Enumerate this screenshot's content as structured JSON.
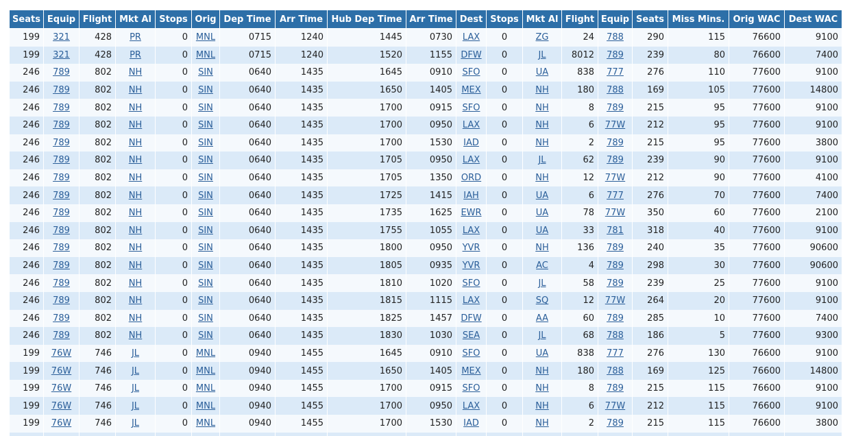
{
  "table": {
    "headers": [
      "Seats",
      "Equip",
      "Flight",
      "Mkt Al",
      "Stops",
      "Orig",
      "Dep Time",
      "Arr Time",
      "Hub Dep Time",
      "Arr Time",
      "Dest",
      "Stops",
      "Mkt Al",
      "Flight",
      "Equip",
      "Seats",
      "Miss Mins.",
      "Orig WAC",
      "Dest WAC"
    ],
    "rows": [
      [
        "199",
        "321",
        "428",
        "PR",
        "0",
        "MNL",
        "0715",
        "1240",
        "1445",
        "0730",
        "LAX",
        "0",
        "ZG",
        "24",
        "788",
        "290",
        "115",
        "76600",
        "9100"
      ],
      [
        "199",
        "321",
        "428",
        "PR",
        "0",
        "MNL",
        "0715",
        "1240",
        "1520",
        "1155",
        "DFW",
        "0",
        "JL",
        "8012",
        "789",
        "239",
        "80",
        "76600",
        "7400"
      ],
      [
        "246",
        "789",
        "802",
        "NH",
        "0",
        "SIN",
        "0640",
        "1435",
        "1645",
        "0910",
        "SFO",
        "0",
        "UA",
        "838",
        "777",
        "276",
        "110",
        "77600",
        "9100"
      ],
      [
        "246",
        "789",
        "802",
        "NH",
        "0",
        "SIN",
        "0640",
        "1435",
        "1650",
        "1405",
        "MEX",
        "0",
        "NH",
        "180",
        "788",
        "169",
        "105",
        "77600",
        "14800"
      ],
      [
        "246",
        "789",
        "802",
        "NH",
        "0",
        "SIN",
        "0640",
        "1435",
        "1700",
        "0915",
        "SFO",
        "0",
        "NH",
        "8",
        "789",
        "215",
        "95",
        "77600",
        "9100"
      ],
      [
        "246",
        "789",
        "802",
        "NH",
        "0",
        "SIN",
        "0640",
        "1435",
        "1700",
        "0950",
        "LAX",
        "0",
        "NH",
        "6",
        "77W",
        "212",
        "95",
        "77600",
        "9100"
      ],
      [
        "246",
        "789",
        "802",
        "NH",
        "0",
        "SIN",
        "0640",
        "1435",
        "1700",
        "1530",
        "IAD",
        "0",
        "NH",
        "2",
        "789",
        "215",
        "95",
        "77600",
        "3800"
      ],
      [
        "246",
        "789",
        "802",
        "NH",
        "0",
        "SIN",
        "0640",
        "1435",
        "1705",
        "0950",
        "LAX",
        "0",
        "JL",
        "62",
        "789",
        "239",
        "90",
        "77600",
        "9100"
      ],
      [
        "246",
        "789",
        "802",
        "NH",
        "0",
        "SIN",
        "0640",
        "1435",
        "1705",
        "1350",
        "ORD",
        "0",
        "NH",
        "12",
        "77W",
        "212",
        "90",
        "77600",
        "4100"
      ],
      [
        "246",
        "789",
        "802",
        "NH",
        "0",
        "SIN",
        "0640",
        "1435",
        "1725",
        "1415",
        "IAH",
        "0",
        "UA",
        "6",
        "777",
        "276",
        "70",
        "77600",
        "7400"
      ],
      [
        "246",
        "789",
        "802",
        "NH",
        "0",
        "SIN",
        "0640",
        "1435",
        "1735",
        "1625",
        "EWR",
        "0",
        "UA",
        "78",
        "77W",
        "350",
        "60",
        "77600",
        "2100"
      ],
      [
        "246",
        "789",
        "802",
        "NH",
        "0",
        "SIN",
        "0640",
        "1435",
        "1755",
        "1055",
        "LAX",
        "0",
        "UA",
        "33",
        "781",
        "318",
        "40",
        "77600",
        "9100"
      ],
      [
        "246",
        "789",
        "802",
        "NH",
        "0",
        "SIN",
        "0640",
        "1435",
        "1800",
        "0950",
        "YVR",
        "0",
        "NH",
        "136",
        "789",
        "240",
        "35",
        "77600",
        "90600"
      ],
      [
        "246",
        "789",
        "802",
        "NH",
        "0",
        "SIN",
        "0640",
        "1435",
        "1805",
        "0935",
        "YVR",
        "0",
        "AC",
        "4",
        "789",
        "298",
        "30",
        "77600",
        "90600"
      ],
      [
        "246",
        "789",
        "802",
        "NH",
        "0",
        "SIN",
        "0640",
        "1435",
        "1810",
        "1020",
        "SFO",
        "0",
        "JL",
        "58",
        "789",
        "239",
        "25",
        "77600",
        "9100"
      ],
      [
        "246",
        "789",
        "802",
        "NH",
        "0",
        "SIN",
        "0640",
        "1435",
        "1815",
        "1115",
        "LAX",
        "0",
        "SQ",
        "12",
        "77W",
        "264",
        "20",
        "77600",
        "9100"
      ],
      [
        "246",
        "789",
        "802",
        "NH",
        "0",
        "SIN",
        "0640",
        "1435",
        "1825",
        "1457",
        "DFW",
        "0",
        "AA",
        "60",
        "789",
        "285",
        "10",
        "77600",
        "7400"
      ],
      [
        "246",
        "789",
        "802",
        "NH",
        "0",
        "SIN",
        "0640",
        "1435",
        "1830",
        "1030",
        "SEA",
        "0",
        "JL",
        "68",
        "788",
        "186",
        "5",
        "77600",
        "9300"
      ],
      [
        "199",
        "76W",
        "746",
        "JL",
        "0",
        "MNL",
        "0940",
        "1455",
        "1645",
        "0910",
        "SFO",
        "0",
        "UA",
        "838",
        "777",
        "276",
        "130",
        "76600",
        "9100"
      ],
      [
        "199",
        "76W",
        "746",
        "JL",
        "0",
        "MNL",
        "0940",
        "1455",
        "1650",
        "1405",
        "MEX",
        "0",
        "NH",
        "180",
        "788",
        "169",
        "125",
        "76600",
        "14800"
      ],
      [
        "199",
        "76W",
        "746",
        "JL",
        "0",
        "MNL",
        "0940",
        "1455",
        "1700",
        "0915",
        "SFO",
        "0",
        "NH",
        "8",
        "789",
        "215",
        "115",
        "76600",
        "9100"
      ],
      [
        "199",
        "76W",
        "746",
        "JL",
        "0",
        "MNL",
        "0940",
        "1455",
        "1700",
        "0950",
        "LAX",
        "0",
        "NH",
        "6",
        "77W",
        "212",
        "115",
        "76600",
        "9100"
      ],
      [
        "199",
        "76W",
        "746",
        "JL",
        "0",
        "MNL",
        "0940",
        "1455",
        "1700",
        "1530",
        "IAD",
        "0",
        "NH",
        "2",
        "789",
        "215",
        "115",
        "76600",
        "3800"
      ],
      [
        "",
        "",
        "",
        "",
        "",
        "",
        "",
        "",
        "",
        "",
        "",
        "",
        "",
        "",
        "",
        "",
        "",
        "",
        ""
      ]
    ]
  }
}
